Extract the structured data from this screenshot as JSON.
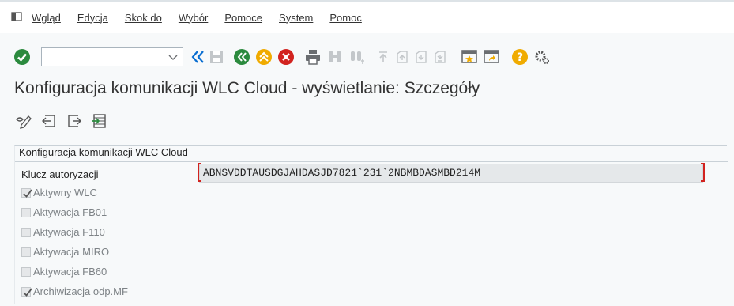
{
  "menu": {
    "items": [
      {
        "label": "Wgląd"
      },
      {
        "label": "Edycja"
      },
      {
        "label": "Skok do"
      },
      {
        "label": "Wybór"
      },
      {
        "label": "Pomoce"
      },
      {
        "label": "System"
      },
      {
        "label": "Pomoc"
      }
    ]
  },
  "toolbar": {
    "command_value": "",
    "icons": [
      "enter-icon",
      "back-exit-icon",
      "save-icon",
      "back-icon",
      "exit-icon",
      "cancel-icon",
      "print-icon",
      "find-icon",
      "find-next-icon",
      "first-page-icon",
      "previous-page-icon",
      "next-page-icon",
      "last-page-icon",
      "create-session-icon",
      "shortcut-icon",
      "help-icon",
      "settings-icon"
    ]
  },
  "page": {
    "title": "Konfiguracja komunikacji WLC Cloud - wyświetlanie: Szczegóły"
  },
  "app_toolbar": {
    "icons": [
      "display-change-icon",
      "previous-entry-icon",
      "next-entry-icon",
      "select-entry-icon"
    ]
  },
  "group": {
    "title": "Konfiguracja komunikacji WLC Cloud",
    "key_label": "Klucz autoryzacji",
    "key_value": "ABNSVDDTAUSDGJAHDASJD7821`231`2NBMBDASMBD214M",
    "checkboxes": [
      {
        "label": "Aktywny WLC",
        "checked": true
      },
      {
        "label": "Aktywacja FB01",
        "checked": false
      },
      {
        "label": "Aktywacja F110",
        "checked": false
      },
      {
        "label": "Aktywacja MIRO",
        "checked": false
      },
      {
        "label": "Aktywacja FB60",
        "checked": false
      },
      {
        "label": "Archiwizacja odp.MF",
        "checked": true
      }
    ]
  },
  "colors": {
    "green": "#2b8a3e",
    "yellow": "#f0ab00",
    "red": "#d2231f",
    "blue": "#0a6ed1",
    "grey": "#6a6d70"
  }
}
